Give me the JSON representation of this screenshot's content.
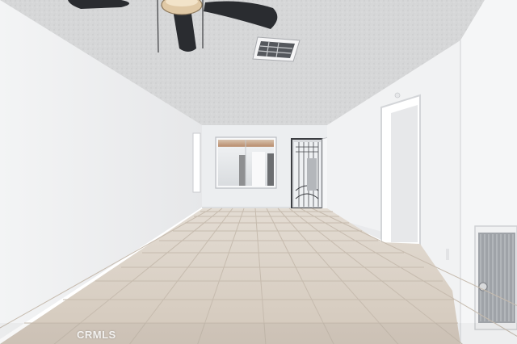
{
  "photo": {
    "subject": "empty room",
    "watermark": "CRMLS"
  },
  "colors": {
    "ceiling": "#d9d9d9",
    "left_wall": "#f2f3f4",
    "back_wall": "#eeeff1",
    "right_wall": "#f4f5f6",
    "floor_tile": "#d8cfc4",
    "grout": "#c2b7aa",
    "fan_blade": "#2a2c30",
    "fan_light": "#e0c9a6"
  }
}
